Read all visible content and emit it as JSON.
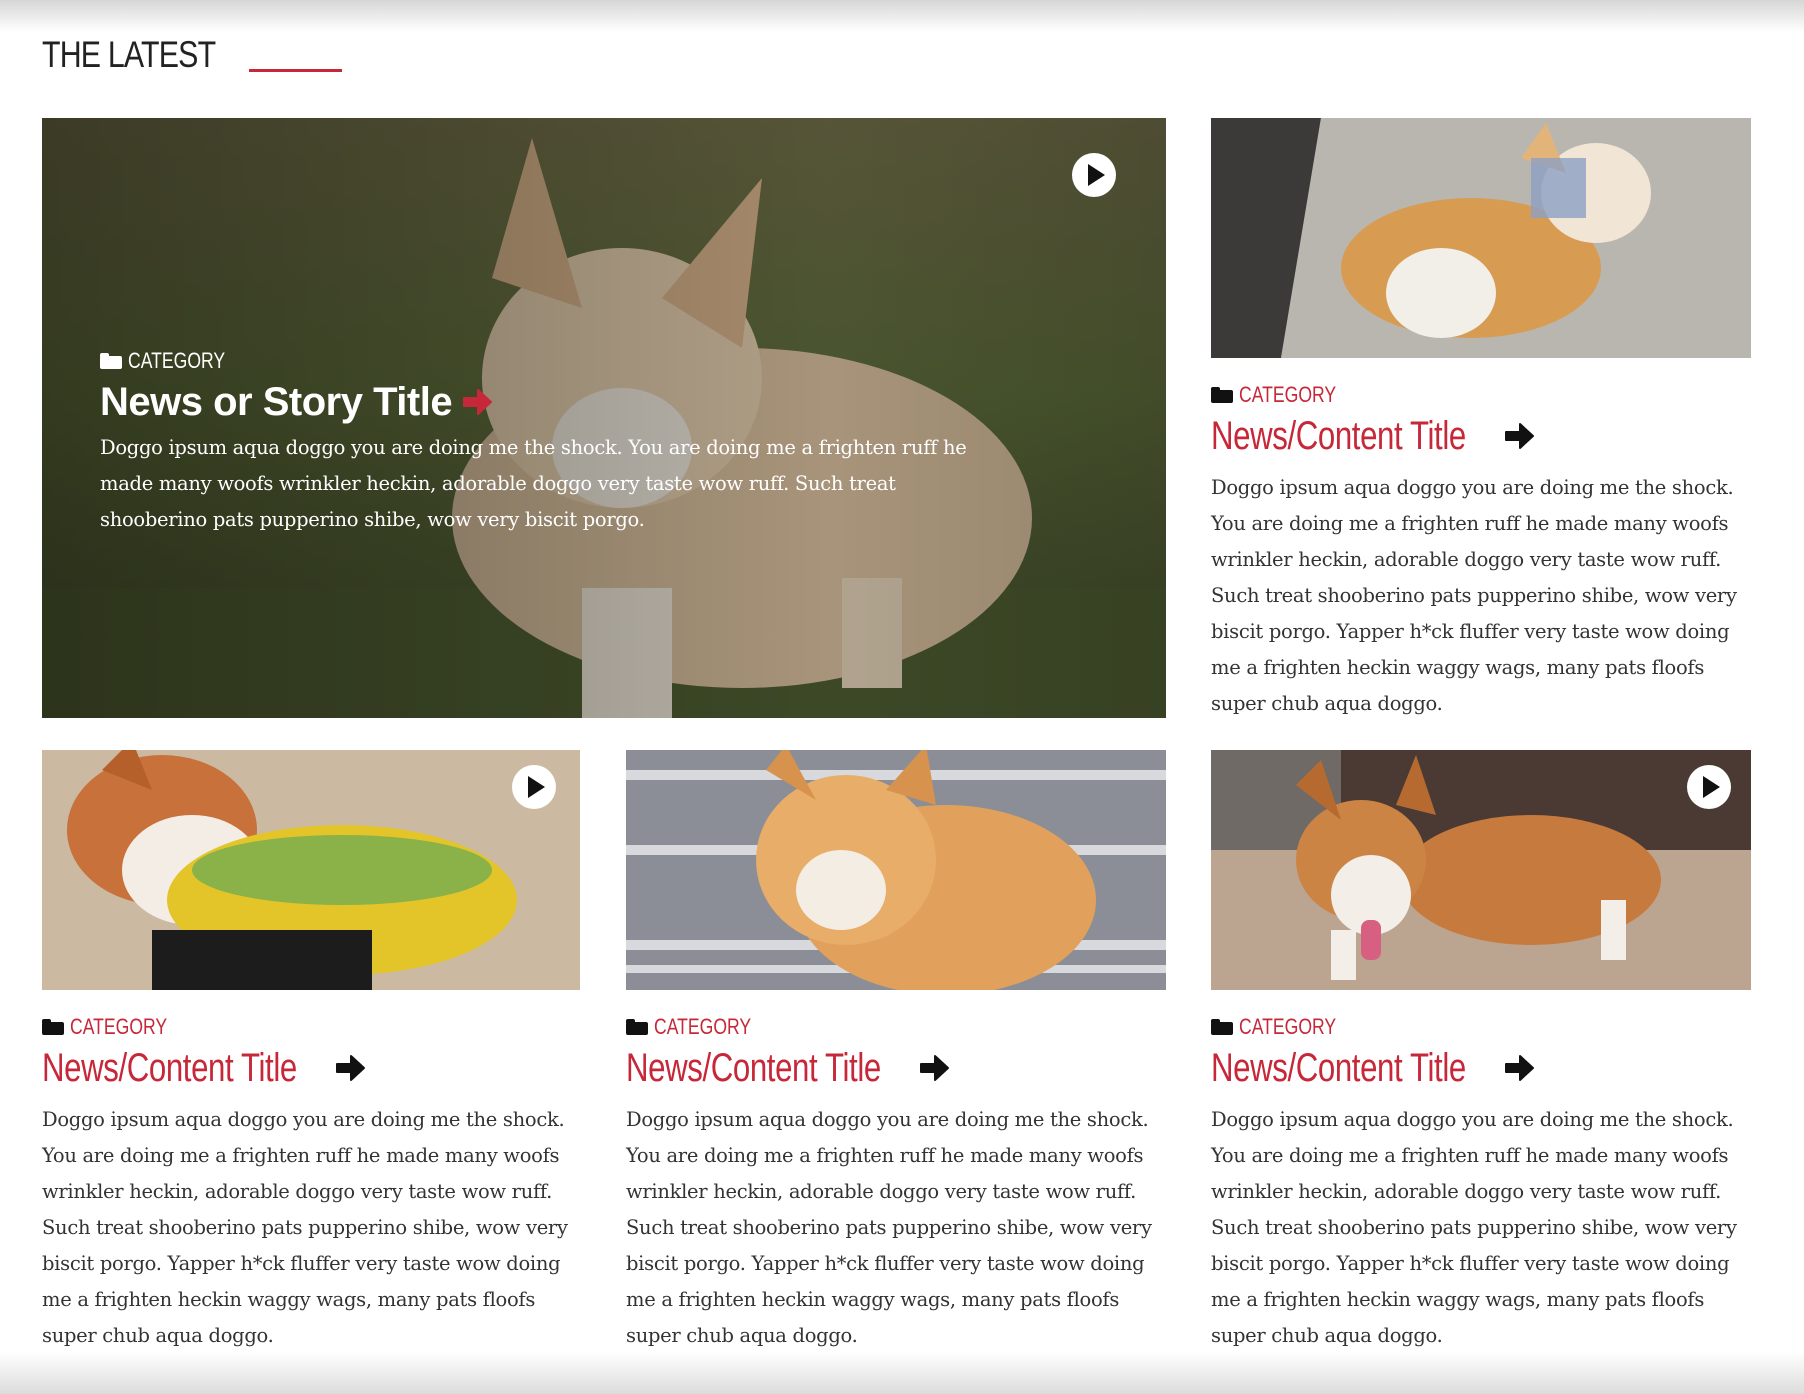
{
  "section": {
    "title": "THE LATEST"
  },
  "colors": {
    "accent": "#c62839",
    "text": "#222222"
  },
  "hero": {
    "category": "CATEGORY",
    "title": "News or Story Title",
    "body": "Doggo ipsum aqua doggo you are doing me the shock. You are doing me a frighten ruff he made many woofs wrinkler heckin, adorable doggo very taste wow ruff. Such treat shooberino pats pupperino shibe, wow very biscit porgo.",
    "image_alt": "corgi puppy on grass",
    "has_video": true
  },
  "cards": [
    {
      "category": "CATEGORY",
      "title": "News/Content Title",
      "body": "Doggo ipsum aqua doggo you are doing me the shock. You are doing me a frighten ruff he made many woofs wrinkler heckin, adorable doggo very taste wow ruff. Such treat shooberino pats pupperino shibe, wow very biscit porgo. Yapper h*ck fluffer very taste wow doing me a frighten heckin waggy wags, many pats floofs super chub aqua doggo.",
      "image_alt": "corgi wearing bandana on sidewalk",
      "has_video": false
    },
    {
      "category": "CATEGORY",
      "title": "News/Content Title",
      "body": "Doggo ipsum aqua doggo you are doing me the shock. You are doing me a frighten ruff he made many woofs wrinkler heckin, adorable doggo very taste wow ruff. Such treat shooberino pats pupperino shibe, wow very biscit porgo. Yapper h*ck fluffer very taste wow doing me a frighten heckin waggy wags, many pats floofs super chub aqua doggo.",
      "image_alt": "corgi in taco costume on sand",
      "has_video": true
    },
    {
      "category": "CATEGORY",
      "title": "News/Content Title",
      "body": "Doggo ipsum aqua doggo you are doing me the shock. You are doing me a frighten ruff he made many woofs wrinkler heckin, adorable doggo very taste wow ruff. Such treat shooberino pats pupperino shibe, wow very biscit porgo. Yapper h*ck fluffer very taste wow doing me a frighten heckin waggy wags, many pats floofs super chub aqua doggo.",
      "image_alt": "happy corgi on crosswalk",
      "has_video": false
    },
    {
      "category": "CATEGORY",
      "title": "News/Content Title",
      "body": "Doggo ipsum aqua doggo you are doing me the shock. You are doing me a frighten ruff he made many woofs wrinkler heckin, adorable doggo very taste wow ruff. Such treat shooberino pats pupperino shibe, wow very biscit porgo. Yapper h*ck fluffer very taste wow doing me a frighten heckin waggy wags, many pats floofs super chub aqua doggo.",
      "image_alt": "corgi with tongue out indoors",
      "has_video": true
    }
  ]
}
